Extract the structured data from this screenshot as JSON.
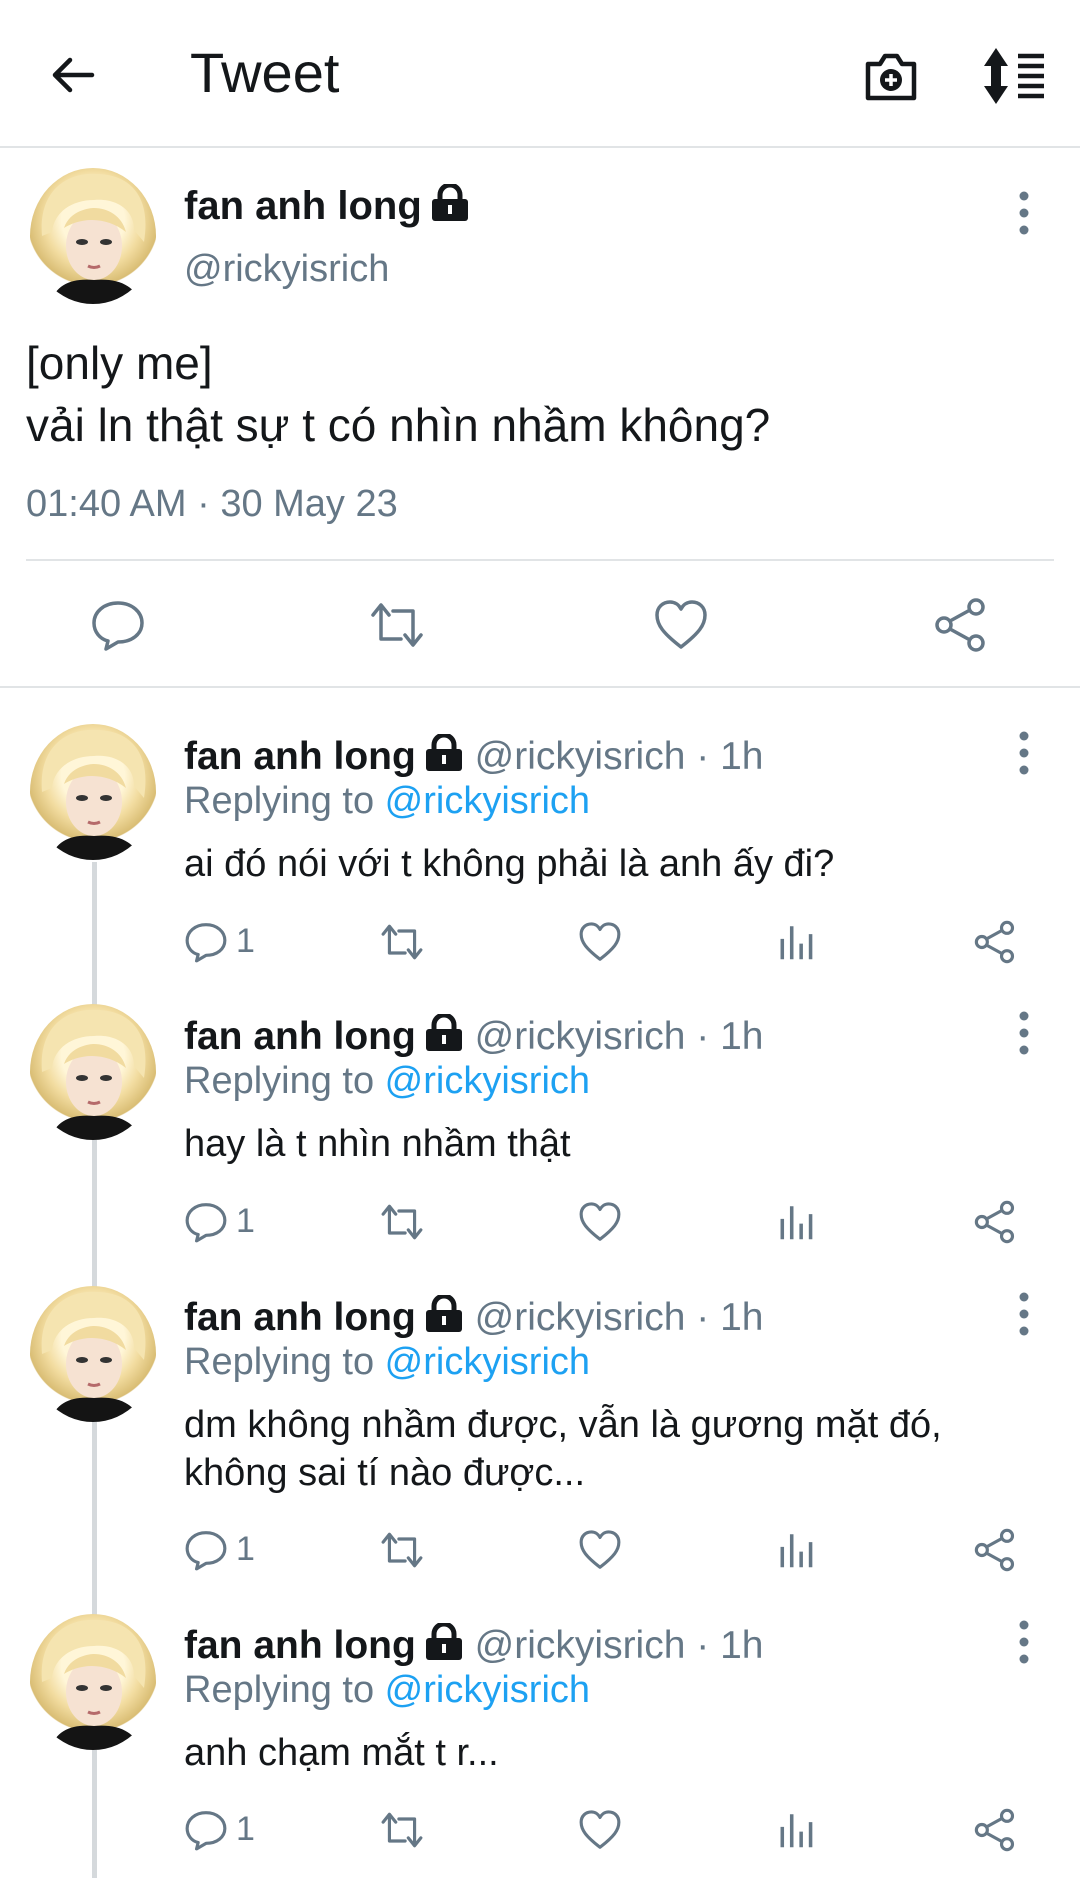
{
  "header": {
    "title": "Tweet"
  },
  "main_tweet": {
    "author_name": "fan anh long",
    "author_handle": "@rickyisrich",
    "text": "[only me]\nvải ln thật sự t có nhìn nhầm không?",
    "timestamp": "01:40 AM · 30 May 23"
  },
  "replies": [
    {
      "author_name": "fan anh long",
      "handle_time": "@rickyisrich · 1h",
      "replying_prefix": "Replying to ",
      "replying_to": "@rickyisrich",
      "text": "ai đó nói với t không phải là anh ấy đi?",
      "reply_count": "1"
    },
    {
      "author_name": "fan anh long",
      "handle_time": "@rickyisrich · 1h",
      "replying_prefix": "Replying to ",
      "replying_to": "@rickyisrich",
      "text": "hay là t nhìn nhầm thật",
      "reply_count": "1"
    },
    {
      "author_name": "fan anh long",
      "handle_time": "@rickyisrich · 1h",
      "replying_prefix": "Replying to ",
      "replying_to": "@rickyisrich",
      "text": "dm không nhầm được, vẫn là gương mặt đó, không sai tí nào được...",
      "reply_count": "1"
    },
    {
      "author_name": "fan anh long",
      "handle_time": "@rickyisrich · 1h",
      "replying_prefix": "Replying to ",
      "replying_to": "@rickyisrich",
      "text": "anh chạm mắt t r...",
      "reply_count": "1"
    }
  ],
  "icons": {
    "back": "arrow-left-icon",
    "camera": "camera-add-icon",
    "sort": "sort-icon",
    "lock": "lock-icon",
    "more": "more-vertical-icon",
    "reply": "reply-icon",
    "retweet": "retweet-icon",
    "like": "heart-icon",
    "analytics": "analytics-icon",
    "share": "share-icon"
  },
  "colors": {
    "link": "#1da1f2",
    "secondary": "#657786",
    "text": "#14171a",
    "divider": "#e1e4e6"
  }
}
